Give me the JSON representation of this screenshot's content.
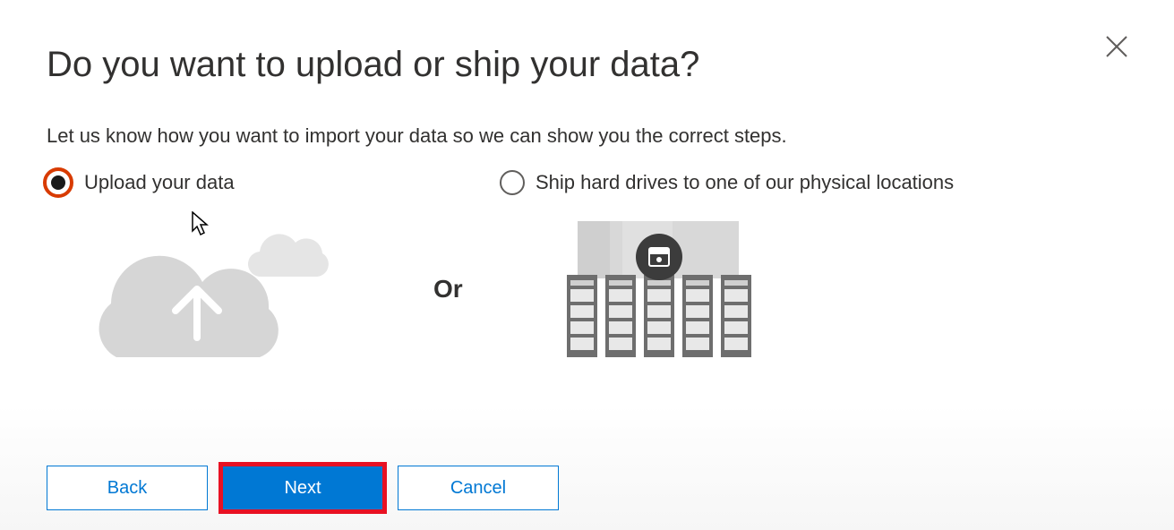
{
  "dialog": {
    "title": "Do you want to upload or ship your data?",
    "subtitle": "Let us know how you want to import your data so we can show you the correct steps.",
    "options": [
      {
        "label": "Upload your data",
        "selected": true
      },
      {
        "label": "Ship hard drives to one of our physical locations",
        "selected": false
      }
    ],
    "separator": "Or",
    "buttons": {
      "back": "Back",
      "next": "Next",
      "cancel": "Cancel"
    }
  }
}
